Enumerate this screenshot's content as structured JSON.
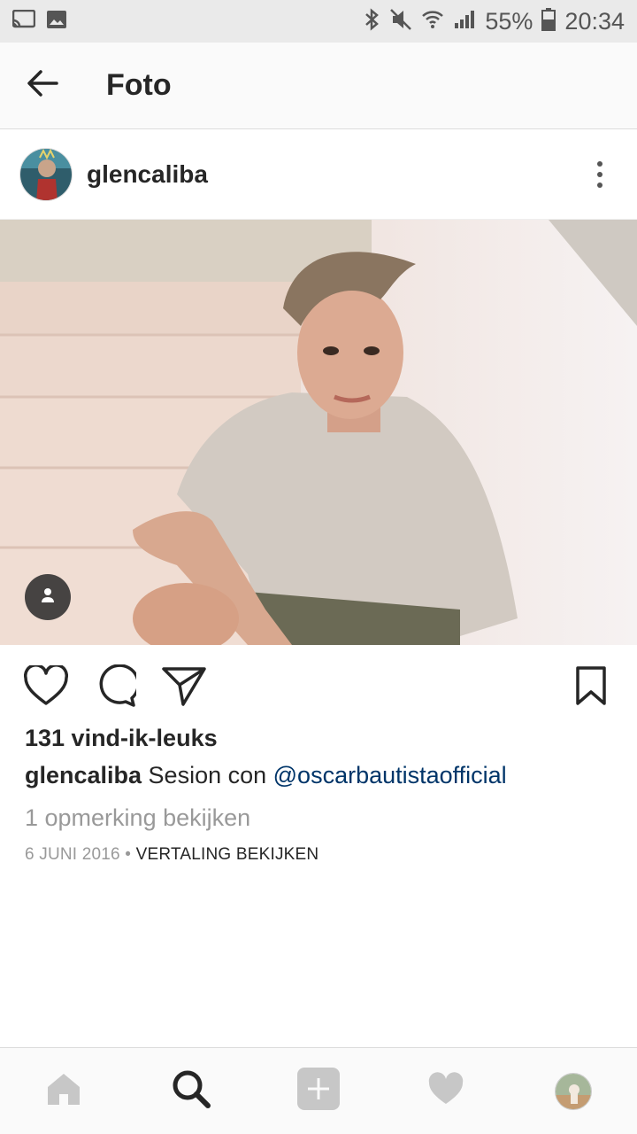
{
  "status_bar": {
    "battery": "55%",
    "time": "20:34",
    "icons": [
      "cast-icon",
      "image-icon",
      "bluetooth-icon",
      "mute-icon",
      "wifi-icon",
      "signal-icon",
      "battery-icon"
    ]
  },
  "app_bar": {
    "title": "Foto",
    "back_icon": "arrow-left-icon"
  },
  "post": {
    "username": "glencaliba",
    "likes": "131 vind-ik-leuks",
    "caption": {
      "user": "glencaliba",
      "text": " Sesion con ",
      "mention": "@oscarbautistaofficial"
    },
    "view_comments": "1 opmerking bekijken",
    "date": "6 JUNI 2016",
    "separator": " • ",
    "translate": "VERTALING BEKIJKEN",
    "actions": [
      "heart-icon",
      "comment-icon",
      "share-icon",
      "bookmark-icon"
    ]
  },
  "bottom_nav": {
    "items": [
      "home-icon",
      "search-icon",
      "add-icon",
      "heart-icon",
      "profile-avatar"
    ]
  },
  "colors": {
    "mention": "#003569",
    "muted": "#999999",
    "text": "#262626",
    "nav_inactive": "#c7c7c7"
  }
}
